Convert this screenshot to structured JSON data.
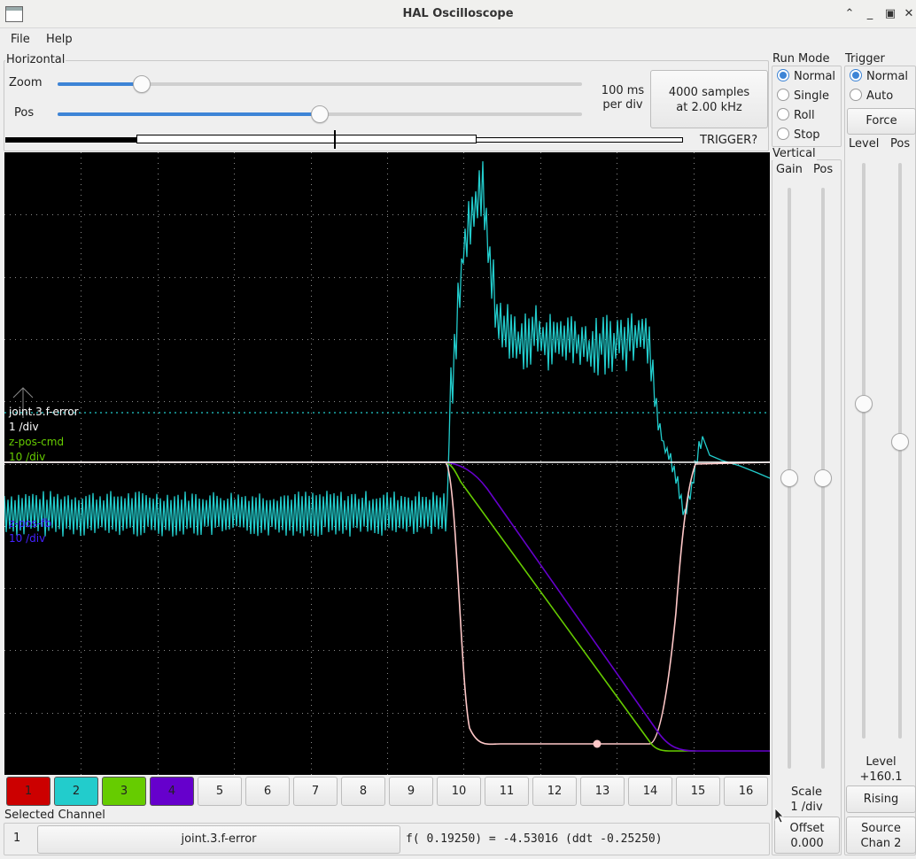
{
  "window": {
    "title": "HAL Oscilloscope"
  },
  "menu": {
    "file": "File",
    "help": "Help"
  },
  "horizontal": {
    "label": "Horizontal",
    "zoom_label": "Zoom",
    "zoom_level": 0.16,
    "pos_label": "Pos",
    "pos_level": 0.5,
    "time_per_div_line1": "100 ms",
    "time_per_div_line2": "per div",
    "samples_line1": "4000 samples",
    "samples_line2": "at 2.00 kHz",
    "trigger_status": "TRIGGER?"
  },
  "run_mode": {
    "label": "Run Mode",
    "options": [
      {
        "label": "Normal",
        "selected": true
      },
      {
        "label": "Single",
        "selected": false
      },
      {
        "label": "Roll",
        "selected": false
      },
      {
        "label": "Stop",
        "selected": false
      }
    ]
  },
  "trigger": {
    "label": "Trigger",
    "options": [
      {
        "label": "Normal",
        "selected": true
      },
      {
        "label": "Auto",
        "selected": false
      }
    ],
    "force_label": "Force",
    "level_label": "Level",
    "pos_label": "Pos",
    "level_title": "Level",
    "level_value": "+160.1",
    "edge_label": "Rising",
    "source_line1": "Source",
    "source_line2": "Chan  2"
  },
  "vertical": {
    "label": "Vertical",
    "gain_label": "Gain",
    "pos_label": "Pos",
    "scale_title": "Scale",
    "scale_value": "1 /div",
    "offset_title": "Offset",
    "offset_value": "0.000"
  },
  "scope": {
    "colors": {
      "background": "#000000",
      "grid": "#8a8a8a",
      "ch1": "#ffc8c8",
      "ch2": "#22cccc",
      "ch3": "#66cc00",
      "ch4": "#6600cc"
    },
    "trace_labels": [
      {
        "text": "joint.3.f-error",
        "color": "#ffffff"
      },
      {
        "text": "1 /div",
        "color": "#ffffff"
      },
      {
        "text": "z-pos-cmd",
        "color": "#66cc00"
      },
      {
        "text": "10 /div",
        "color": "#66cc00"
      },
      {
        "text": "z-pos-fb",
        "color": "#4422ff"
      },
      {
        "text": "10 /div",
        "color": "#4422ff"
      }
    ]
  },
  "channels": [
    {
      "label": "1",
      "color": "#cc0000"
    },
    {
      "label": "2",
      "color": "#22cccc"
    },
    {
      "label": "3",
      "color": "#66cc00"
    },
    {
      "label": "4",
      "color": "#6600cc"
    },
    {
      "label": "5",
      "color": ""
    },
    {
      "label": "6",
      "color": ""
    },
    {
      "label": "7",
      "color": ""
    },
    {
      "label": "8",
      "color": ""
    },
    {
      "label": "9",
      "color": ""
    },
    {
      "label": "10",
      "color": ""
    },
    {
      "label": "11",
      "color": ""
    },
    {
      "label": "12",
      "color": ""
    },
    {
      "label": "13",
      "color": ""
    },
    {
      "label": "14",
      "color": ""
    },
    {
      "label": "15",
      "color": ""
    },
    {
      "label": "16",
      "color": ""
    }
  ],
  "selected_channel": {
    "label": "Selected Channel",
    "number": "1",
    "name": "joint.3.f-error",
    "readout": "f( 0.19250) = -4.53016 (ddt -0.25250)"
  }
}
